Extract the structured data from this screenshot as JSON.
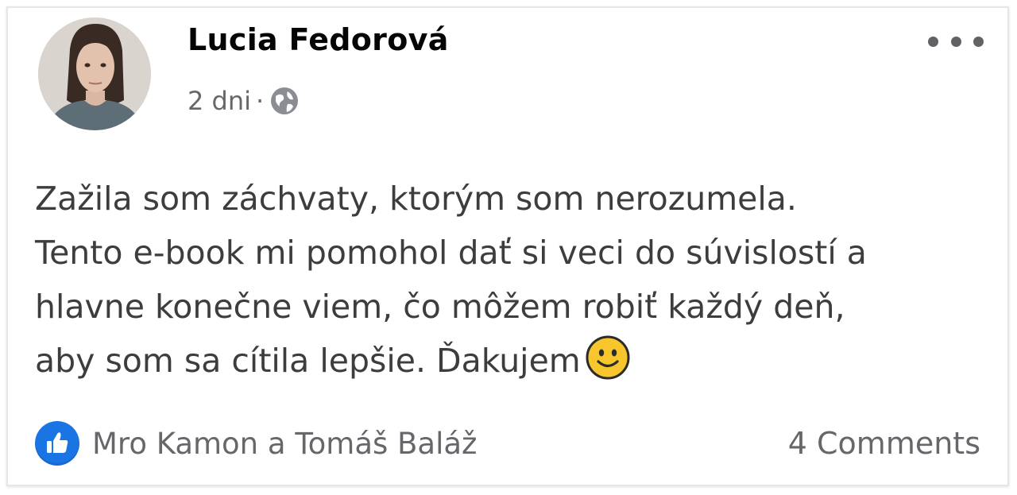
{
  "post": {
    "author": "Lucia Fedorová",
    "time": "2 dni",
    "separator": "·",
    "audience_icon": "globe-icon",
    "more_icon": "more-options-icon",
    "text_lines": [
      "Zažila som záchvaty, ktorým som nerozumela.",
      "Tento e-book mi pomohol dať si veci do súvislostí a",
      "hlavne konečne viem, čo môžem robiť každý deň,",
      "aby som sa cítila lepšie. Ďakujem"
    ],
    "emoji": "slightly-smiling-face-icon",
    "reactions": {
      "icon": "like-thumb-icon",
      "names": "Mro Kamon a Tomáš Baláž"
    },
    "comments": "4 Comments"
  },
  "colors": {
    "like_blue": "#1b74e4",
    "meta_gray": "#65676b",
    "text": "#3e3c3c",
    "name": "#050505"
  }
}
